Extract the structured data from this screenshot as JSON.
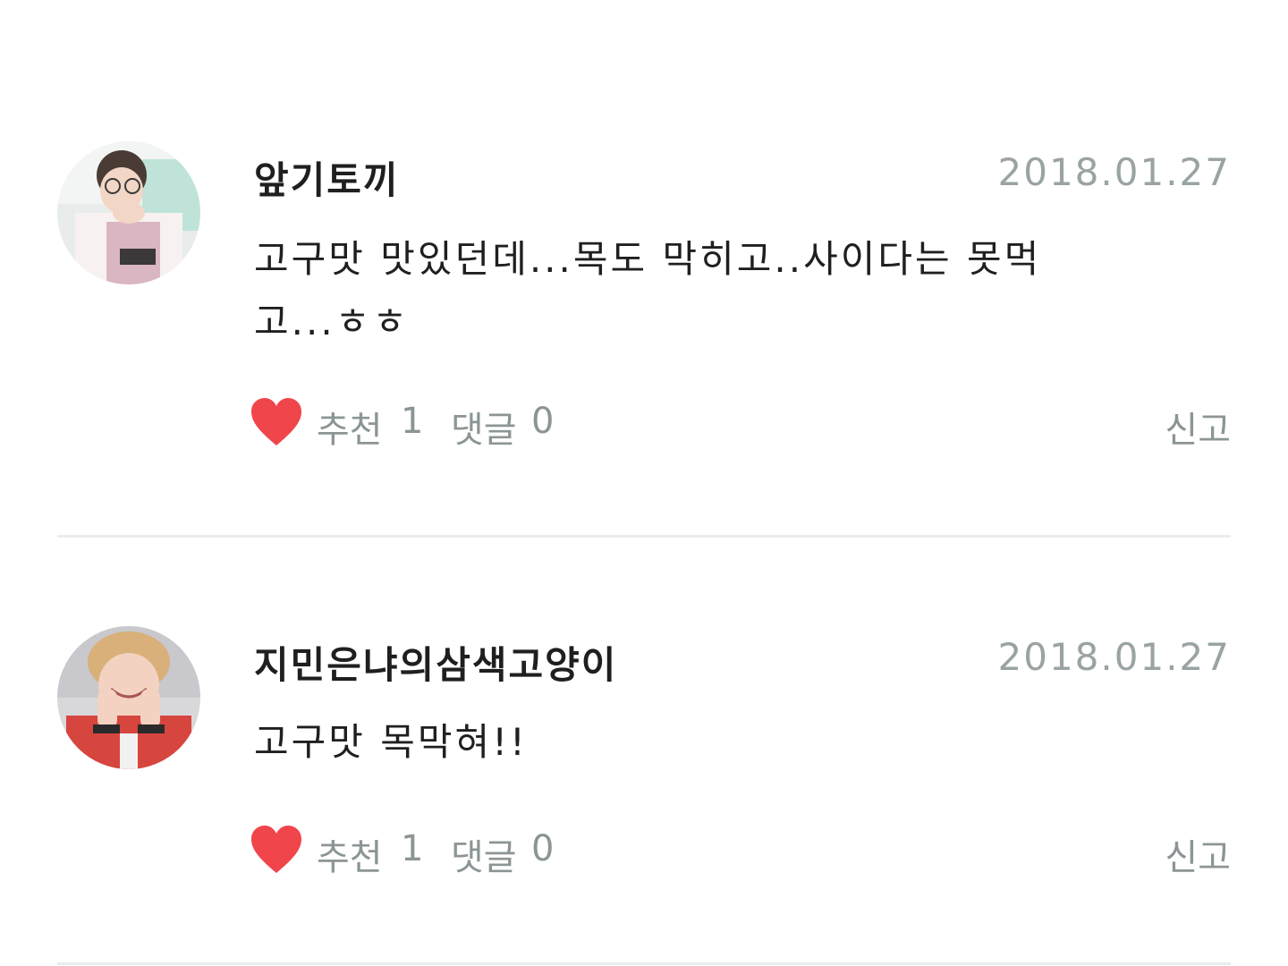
{
  "comments": [
    {
      "author": "앞기토끼",
      "date": "2018.01.27",
      "text": "고구맛 맛있던데...목도 막히고..사이다는 못먹고...ㅎㅎ",
      "like_label": "추천",
      "like_count": "1",
      "reply_label": "댓글",
      "reply_count": "0",
      "report_label": "신고",
      "avatar_icon": "user-avatar-photo",
      "heart_icon": "heart-icon",
      "heart_color": "#f0454b"
    },
    {
      "author": "지민은냐의삼색고양이",
      "date": "2018.01.27",
      "text": "고구맛 목막혀!!",
      "like_label": "추천",
      "like_count": "1",
      "reply_label": "댓글",
      "reply_count": "0",
      "report_label": "신고",
      "avatar_icon": "user-avatar-photo",
      "heart_icon": "heart-icon",
      "heart_color": "#f0454b"
    }
  ],
  "colors": {
    "meta_text": "#8c9595",
    "date_text": "#9aa3a3",
    "divider": "#e9eded",
    "heart": "#f0454b"
  }
}
